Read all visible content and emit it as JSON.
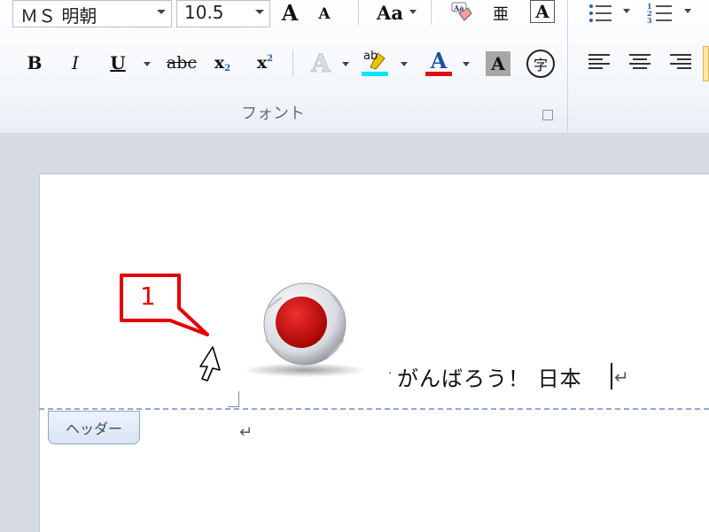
{
  "ribbon": {
    "font_name": "ＭＳ 明朝",
    "font_size": "10.5",
    "group_label": "フォント",
    "grow_font": "A",
    "shrink_font": "A",
    "change_case": "Aa",
    "phonetic_guide": "亜",
    "character_border": "A",
    "bold": "B",
    "italic": "I",
    "underline": "U",
    "strikethrough": "abc",
    "subscript": "x",
    "subscript_mark": "2",
    "superscript": "x",
    "superscript_mark": "2",
    "text_effect": "A",
    "highlight": "ab",
    "font_color": "A",
    "char_shading": "A",
    "enclose_char": "字",
    "colors": {
      "highlight_bar": "#00e5ff",
      "font_color_bar": "#e01010",
      "accent": "#d00000"
    }
  },
  "document": {
    "header_text": "がんばろう！ 日本",
    "header_label": "ヘッダー",
    "para_mark": "↵",
    "callout_number": "1"
  }
}
